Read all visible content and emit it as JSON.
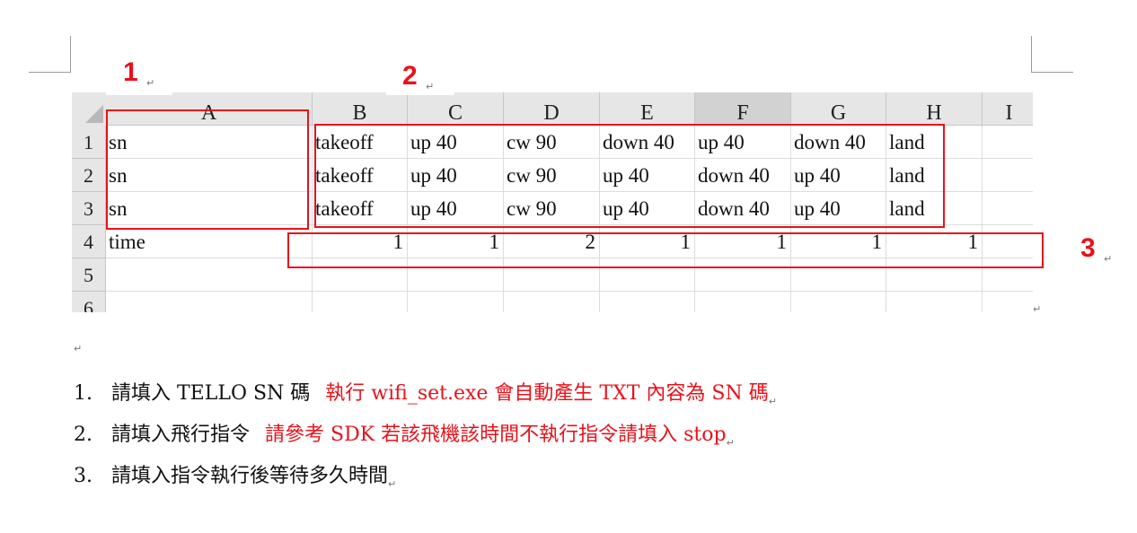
{
  "sheet": {
    "columns": [
      "A",
      "B",
      "C",
      "D",
      "E",
      "F",
      "G",
      "H",
      "I"
    ],
    "selected_column": "F",
    "row_numbers": [
      "1",
      "2",
      "3",
      "4",
      "5",
      "6"
    ],
    "rows": [
      [
        "sn",
        "takeoff",
        "up 40",
        "cw 90",
        "down 40",
        "up 40",
        "down 40",
        "land",
        ""
      ],
      [
        "sn",
        "takeoff",
        "up 40",
        "cw 90",
        "up 40",
        "down 40",
        "up 40",
        "land",
        ""
      ],
      [
        "sn",
        "takeoff",
        "up 40",
        "cw 90",
        "up 40",
        "down 40",
        "up 40",
        "land",
        ""
      ],
      [
        "time",
        "1",
        "1",
        "2",
        "1",
        "1",
        "1",
        "1",
        ""
      ],
      [
        "",
        "",
        "",
        "",
        "",
        "",
        "",
        "",
        ""
      ],
      [
        "",
        "",
        "",
        "",
        "",
        "",
        "",
        "",
        ""
      ]
    ]
  },
  "labels": {
    "one": "1",
    "two": "2",
    "three": "3"
  },
  "notes": [
    {
      "num": "1.",
      "black": "請填入 TELLO SN 碼",
      "red": "執行 wifi_set.exe 會自動產生 TXT 內容為 SN 碼"
    },
    {
      "num": "2.",
      "black": "請填入飛行指令",
      "red": "請參考 SDK 若該飛機該時間不執行指令請填入 stop"
    },
    {
      "num": "3.",
      "black": "請填入指令執行後等待多久時間",
      "red": ""
    }
  ],
  "paragraph_mark": "↵",
  "colors": {
    "annotation_red": "#e8121b",
    "selected_column_accent": "#217346"
  }
}
